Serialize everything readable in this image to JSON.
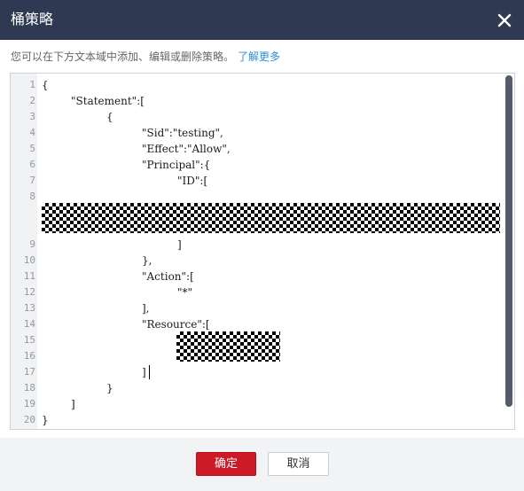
{
  "dialog": {
    "title": "桶策略",
    "close_icon": "close-icon"
  },
  "hint": {
    "text": "您可以在下方文本域中添加、编辑或删除策略。",
    "link": "了解更多"
  },
  "editor": {
    "line_numbers": [
      "1",
      "2",
      "3",
      "4",
      "5",
      "6",
      "7",
      "8",
      "9",
      "10",
      "11",
      "12",
      "13",
      "14",
      "15",
      "16",
      "17",
      "18",
      "19",
      "20"
    ],
    "lines": [
      "{",
      "\"Statement\":[",
      "{",
      "\"Sid\":\"testing\",",
      "\"Effect\":\"Allow\",",
      "\"Principal\":{",
      "\"ID\":[",
      "",
      "]",
      "},",
      "\"Action\":[",
      "\"*\"",
      "],",
      "\"Resource\":[",
      "",
      "",
      "]",
      "}",
      "]",
      "}"
    ]
  },
  "footer": {
    "confirm_label": "确定",
    "cancel_label": "取消"
  },
  "colors": {
    "titlebar": "#303952",
    "confirm": "#cc1a26",
    "link": "#2b8fd8"
  }
}
